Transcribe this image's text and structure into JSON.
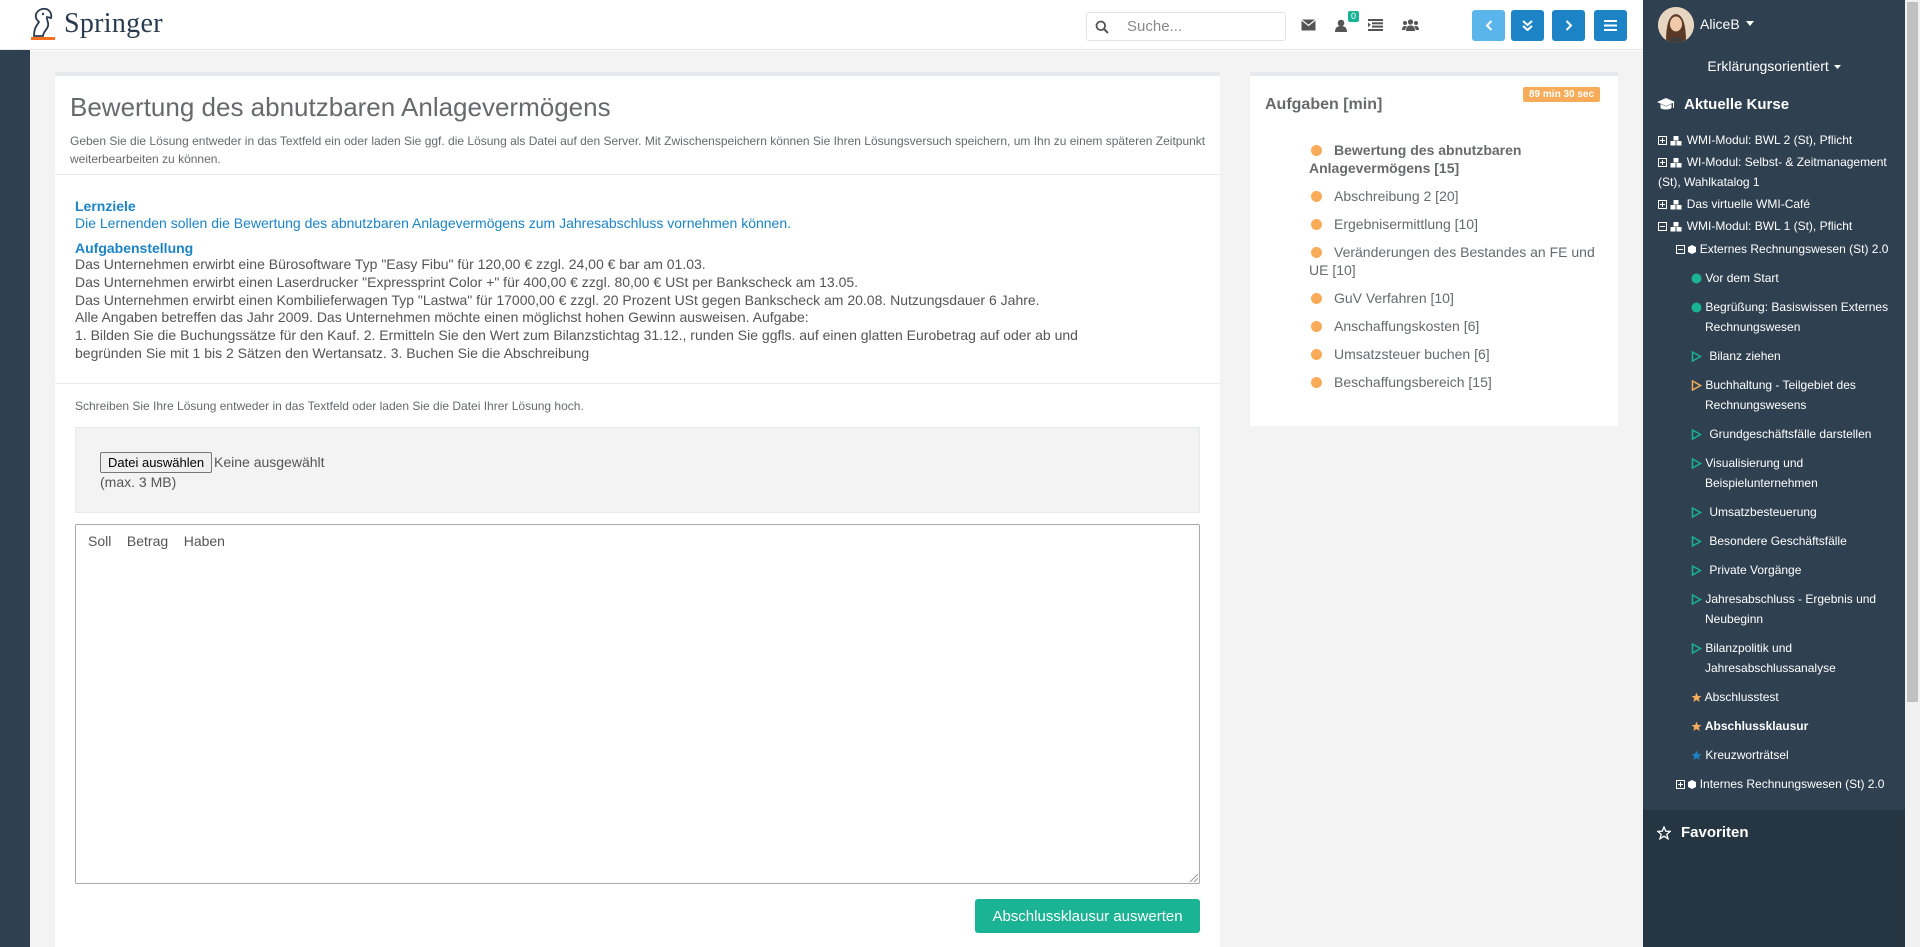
{
  "header": {
    "logo_text": "Springer",
    "search_placeholder": "Suche...",
    "notification_count": "0"
  },
  "task": {
    "title": "Bewertung des abnutzbaren Anlagevermögens",
    "intro": "Geben Sie die Lösung entweder in das Textfeld ein oder laden Sie ggf. die Lösung als Datei auf den Server. Mit Zwischenspeichern können Sie Ihren Lösungsversuch speichern, um Ihn zu einem späteren Zeitpunkt weiterbearbeiten zu können.",
    "lernziele_head": "Lernziele",
    "lernziele_text": "Die Lernenden sollen die Bewertung des abnutzbaren Anlagevermögens zum Jahresabschluss vornehmen können.",
    "aufgabe_head": "Aufgabenstellung",
    "aufgabe_lines": [
      "Das Unternehmen erwirbt eine Bürosoftware Typ \"Easy Fibu\" für 120,00 € zzgl. 24,00 € bar am 01.03.",
      "Das Unternehmen erwirbt einen Laserdrucker \"Expressprint Color +\" für 400,00 € zzgl. 80,00 € USt per Bankscheck am 13.05.",
      "Das Unternehmen erwirbt einen Kombilieferwagen Typ \"Lastwa\" für 17000,00 € zzgl. 20 Prozent USt gegen Bankscheck am 20.08. Nutzungsdauer 6 Jahre.",
      "Alle Angaben betreffen das Jahr 2009. Das Unternehmen möchte einen möglichst hohen Gewinn ausweisen. Aufgabe:",
      "1. Bilden Sie die Buchungssätze für den Kauf. 2. Ermitteln Sie den Wert zum Bilanzstichtag 31.12., runden Sie ggfls. auf einen glatten Eurobetrag auf oder ab und",
      "begründen Sie mit 1 bis 2 Sätzen den Wertansatz. 3. Buchen Sie die Abschreibung"
    ],
    "upload_hint": "Schreiben Sie Ihre Lösung entweder in das Textfeld oder laden Sie die Datei Ihrer Lösung hoch.",
    "file_button": "Datei auswählen",
    "file_none": "Keine ausgewählt",
    "file_max": "(max. 3 MB)",
    "answer_value": "Soll    Betrag    Haben",
    "submit_label": "Abschlussklausur auswerten"
  },
  "aufgaben": {
    "title": "Aufgaben [min]",
    "timer": "89 min 30 sec",
    "items": [
      {
        "label": "Bewertung des abnutzbaren Anlagevermögens [15]",
        "active": true
      },
      {
        "label": "Abschreibung 2 [20]",
        "active": false
      },
      {
        "label": "Ergebnisermittlung [10]",
        "active": false
      },
      {
        "label": "Veränderungen des Bestandes an FE und UE [10]",
        "active": false
      },
      {
        "label": "GuV Verfahren [10]",
        "active": false
      },
      {
        "label": "Anschaffungskosten [6]",
        "active": false
      },
      {
        "label": "Umsatzsteuer buchen [6]",
        "active": false
      },
      {
        "label": "Beschaffungsbereich [15]",
        "active": false
      }
    ]
  },
  "sidebar": {
    "user_name": "AliceB",
    "mode": "Erklärungsorientiert",
    "kurse_head": "Aktuelle Kurse",
    "courses": [
      "WMI-Modul: BWL 2 (St), Pflicht",
      "WI-Modul: Selbst- & Zeitmanagement",
      "(St), Wahlkatalog 1",
      "Das virtuelle WMI-Café",
      "WMI-Modul: BWL 1 (St), Pflicht",
      "Externes Rechnungswesen (St) 2.0"
    ],
    "lessons": [
      "Vor dem Start",
      "Begrüßung: Basiswissen Externes",
      "Rechnungswesen",
      "Bilanz ziehen",
      "Buchhaltung - Teilgebiet des",
      "Rechnungswesens",
      "Grundgeschäftsfälle darstellen",
      "Visualisierung und",
      "Beispielunternehmen",
      "Umsatzbesteuerung",
      "Besondere Geschäftsfälle",
      "Private Vorgänge",
      "Jahresabschluss - Ergebnis und",
      "Neubeginn",
      "Bilanzpolitik und",
      "Jahresabschlussanalyse",
      "Abschlusstest",
      "Abschlussklausur",
      "Kreuzworträtsel",
      "Internes Rechnungswesen (St) 2.0"
    ],
    "fav_head": "Favoriten"
  },
  "colors": {
    "primary": "#1c84c6",
    "accent": "#1ab394",
    "warning": "#f8ac59",
    "sidebar": "#2f4050"
  }
}
